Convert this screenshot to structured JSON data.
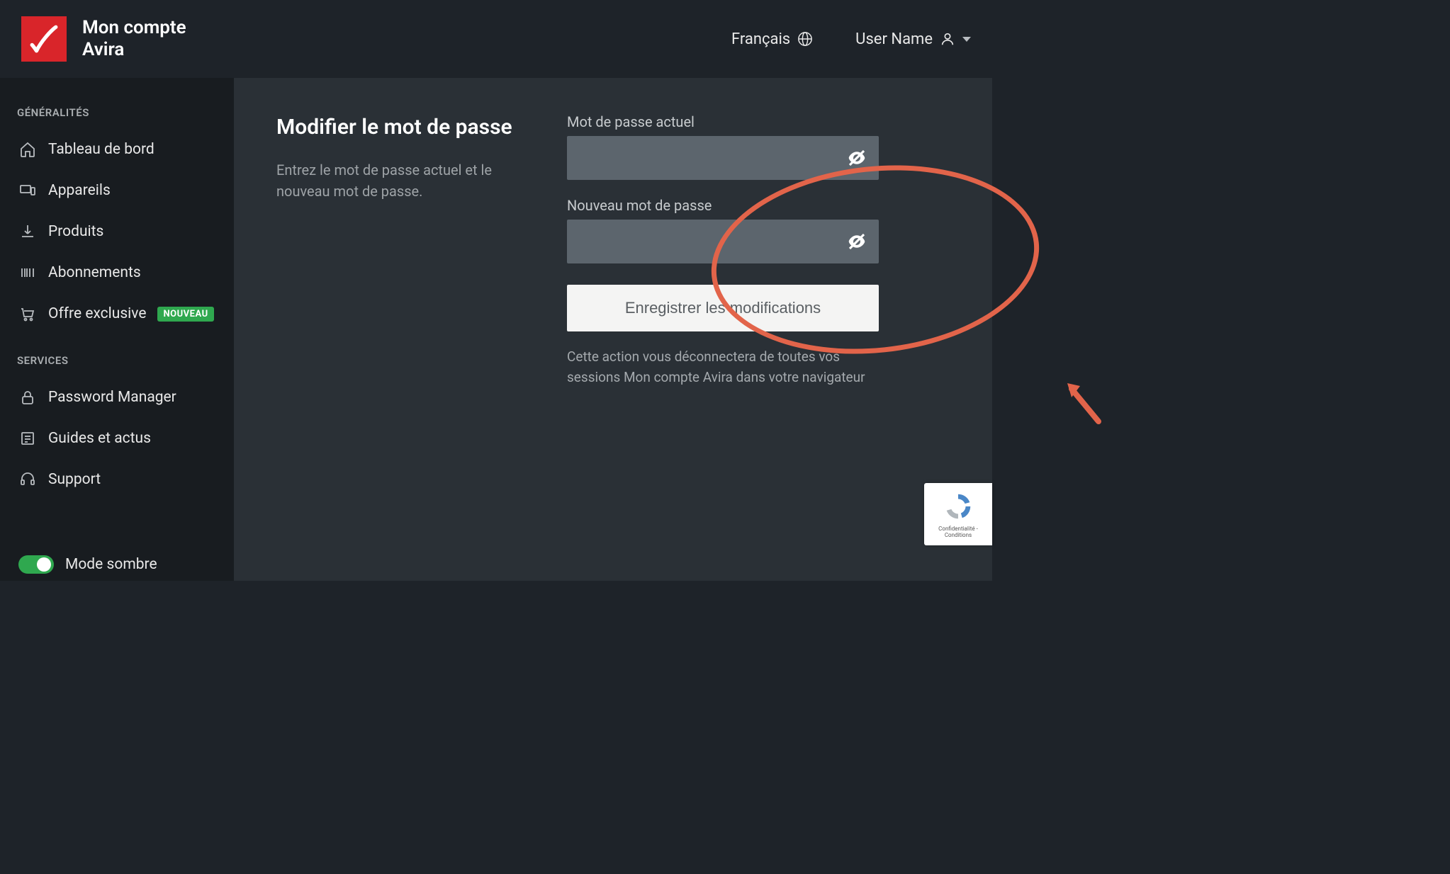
{
  "header": {
    "brand_title": "Mon compte Avira",
    "language_label": "Français",
    "user_label": "User Name"
  },
  "sidebar": {
    "section1_title": "GÉNÉRALITÉS",
    "items1": [
      {
        "label": "Tableau de bord"
      },
      {
        "label": "Appareils"
      },
      {
        "label": "Produits"
      },
      {
        "label": "Abonnements"
      },
      {
        "label": "Offre exclusive",
        "badge": "NOUVEAU"
      }
    ],
    "section2_title": "SERVICES",
    "items2": [
      {
        "label": "Password Manager"
      },
      {
        "label": "Guides et actus"
      },
      {
        "label": "Support"
      }
    ],
    "dark_mode_label": "Mode sombre"
  },
  "main": {
    "heading": "Modifier le mot de passe",
    "subtext": "Entrez le mot de passe actuel et le nouveau mot de passe.",
    "current_pw_label": "Mot de passe actuel",
    "new_pw_label": "Nouveau mot de passe",
    "save_label": "Enregistrer les modifications",
    "hint": "Cette action vous déconnectera de toutes vos sessions Mon compte Avira dans votre navigateur"
  },
  "recaptcha": {
    "footer": "Confidentialité - Conditions"
  }
}
